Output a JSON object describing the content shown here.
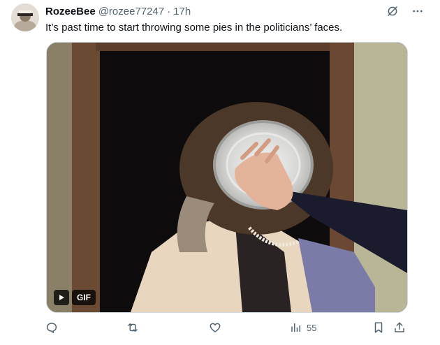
{
  "tweet": {
    "author": {
      "name": "RozeeBee",
      "handle": "@rozee77247",
      "separator": "·",
      "time": "17h"
    },
    "text": "It’s past time to start throwing some pies in the politicians’ faces.",
    "media": {
      "type": "gif",
      "badge_label": "GIF"
    },
    "actions": {
      "views_count": "55"
    },
    "icons": {
      "grok": "grok-slash-icon",
      "more": "more-dots-icon",
      "reply": "reply-bubble-icon",
      "retweet": "retweet-icon",
      "like": "heart-icon",
      "views": "views-bars-icon",
      "bookmark": "bookmark-icon",
      "share": "share-icon"
    },
    "colors": {
      "text_primary": "#0f1419",
      "text_secondary": "#536471",
      "badge_bg": "#000000c4"
    }
  }
}
